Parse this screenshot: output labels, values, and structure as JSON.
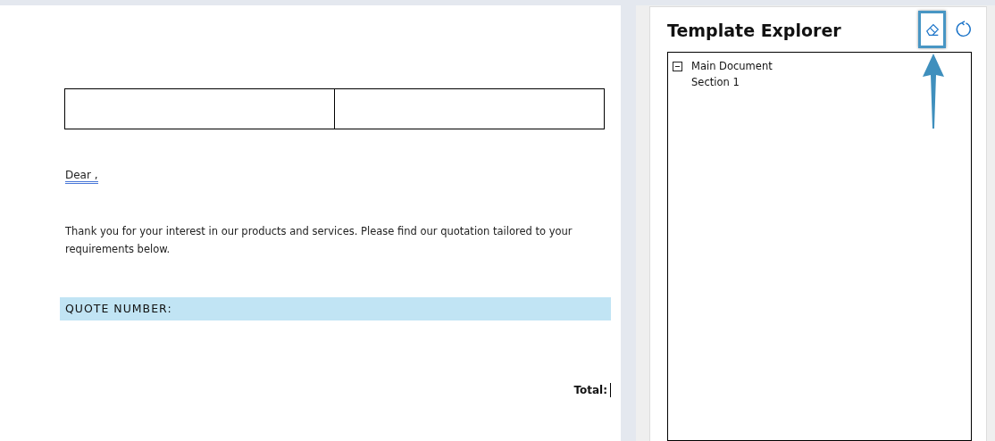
{
  "document": {
    "greeting": "Dear ,",
    "paragraph": "Thank you for your interest in our products and services.  Please find our quotation tailored to your requirements below.",
    "quote_band": "QUOTE NUMBER:",
    "total_label": "Total:"
  },
  "panel": {
    "title": "Template Explorer",
    "tools": [
      {
        "kind": "eraser",
        "highlighted": true
      },
      {
        "kind": "refresh",
        "highlighted": false
      }
    ],
    "tree": [
      {
        "label": "Main Document",
        "expanded": true,
        "children": [
          {
            "label": "Section 1"
          }
        ]
      }
    ]
  }
}
